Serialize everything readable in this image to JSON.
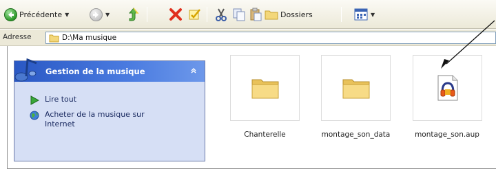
{
  "toolbar": {
    "back_label": "Précédente",
    "folders_label": "Dossiers"
  },
  "address": {
    "label": "Adresse",
    "path": "D:\\Ma musique"
  },
  "taskpane": {
    "title": "Gestion de la musique",
    "items": [
      {
        "label": "Lire tout",
        "icon": "play-icon"
      },
      {
        "label": "Acheter de la musique sur Internet",
        "icon": "globe-icon"
      }
    ]
  },
  "files": [
    {
      "name": "Chanterelle",
      "icon": "folder-icon"
    },
    {
      "name": "montage_son_data",
      "icon": "folder-icon"
    },
    {
      "name": "montage_son.aup",
      "icon": "audacity-file-icon"
    }
  ],
  "colors": {
    "taskpane_header": "#2a58c4",
    "taskpane_body": "#d6dff5",
    "delete_red": "#e0301e",
    "folder_yellow": "#f3d77a"
  }
}
